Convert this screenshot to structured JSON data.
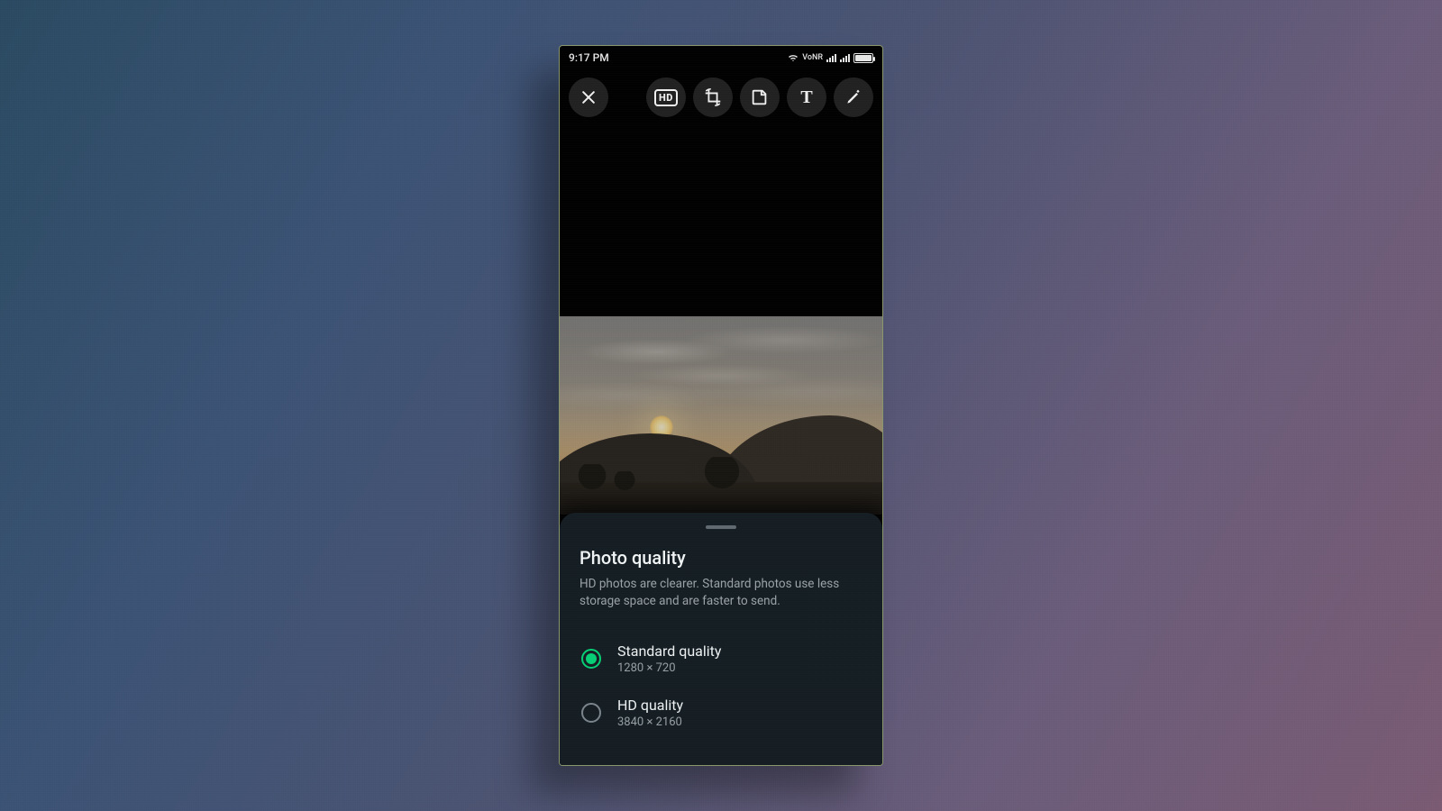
{
  "status": {
    "time": "9:17 PM",
    "network_label": "VoNR",
    "battery_pct": 95
  },
  "toolbar": {
    "hd_label": "HD",
    "text_tool_label": "T"
  },
  "sheet": {
    "title": "Photo quality",
    "description": "HD photos are clearer. Standard photos use less storage space and are faster to send.",
    "options": [
      {
        "label": "Standard quality",
        "resolution": "1280 × 720",
        "selected": true
      },
      {
        "label": "HD quality",
        "resolution": "3840 × 2160",
        "selected": false
      }
    ]
  }
}
